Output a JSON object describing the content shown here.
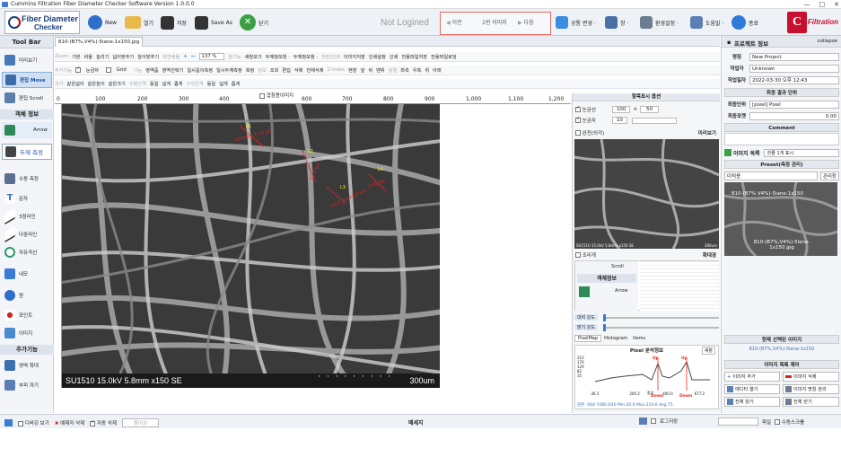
{
  "window": {
    "title": "Cummins Filtration Fiber Diameter Checker Software Version 1.0.0.0",
    "controls": [
      "—",
      "□",
      "✕"
    ]
  },
  "ribbon": {
    "logo_line1": "Fiber Diameter",
    "logo_line2": "Checker",
    "new": "New",
    "open": "열기",
    "save": "저장",
    "save_as": "Save As",
    "close": "닫기",
    "login_status": "Not Logined",
    "nav": {
      "prev": "이전",
      "page": "1번 이미지",
      "next": "다음"
    },
    "common_change": "공통 변경 ·",
    "window": "창 ·",
    "env_settings": "환경설정 ·",
    "help": "도움말 ·",
    "exit": "종료",
    "brand_logo": "C",
    "brand": "Filtration"
  },
  "left_toolbar": {
    "header": "Tool Bar",
    "items": [
      {
        "label": "미리보기"
      },
      {
        "label": "편집 Move"
      },
      {
        "label": "편집 Scroll"
      },
      {
        "label": "Arrow"
      },
      {
        "label": "두께 측정"
      },
      {
        "label": "수동 측정"
      },
      {
        "label": "문자"
      },
      {
        "label": "3점라인"
      },
      {
        "label": "다중라인"
      },
      {
        "label": "자유곡선"
      },
      {
        "label": "네모"
      },
      {
        "label": "원"
      },
      {
        "label": "포인트"
      },
      {
        "label": "이미지"
      },
      {
        "label": "영역 확대"
      },
      {
        "label": "부피 까기"
      }
    ],
    "section_object": "객체 정보",
    "section_extra": "추가기능"
  },
  "image_tab": "810-(B7%,V4%)-5lane-1x150.jpg",
  "toolbar_row1": [
    "Zoom",
    "기본",
    "비율",
    "늘리기",
    "넓이맞추기",
    "높이맞추기",
    "화면배율",
    "137 %",
    "창기능",
    "새창보기",
    "두께정보창 ·",
    "두께정보창 ·",
    "저장/인쇄",
    "이미지저장",
    "인쇄설정",
    "인쇄",
    "전용파일저장",
    "전용파일로딩"
  ],
  "toolbar_row2": [
    "추가기능",
    "눈금자",
    "Grid",
    "기능",
    "영역줌",
    "영역선택기",
    "일시길이측정",
    "일시두께측정",
    "측정",
    "정보",
    "조회",
    "편집",
    "삭제",
    "전체삭제",
    "Z-index",
    "현장",
    "앞",
    "뒤",
    "맨위",
    "정렬",
    "좌측",
    "우측",
    "위",
    "아래"
  ],
  "toolbar_row3": [
    "크기",
    "같은넓이",
    "같은높이",
    "같은크기",
    "수평간격",
    "동일",
    "넓게",
    "좁게",
    "수직간격",
    "동일",
    "넓게",
    "좁게"
  ],
  "ruler_label": "겹침용이미지",
  "ruler_ticks": [
    "0",
    "100",
    "200",
    "300",
    "400",
    "500",
    "600",
    "700",
    "800",
    "900",
    "1,000",
    "1,100",
    "1,200"
  ],
  "sem": {
    "info": "SU1510 15.0kV 5.8mm x150 SE",
    "scale": "300um",
    "labels": [
      "L1",
      "L2",
      "L3",
      "L4"
    ],
    "measurements": [
      "13.6mm 17.0 µm",
      "12.3 µm",
      "10.3 µm 19.2 µm",
      "14.0 µm"
    ]
  },
  "right_panel": {
    "display_options": "항목표시 옵션",
    "ruler": "눈금선",
    "ruler_values": [
      "100",
      "50"
    ],
    "ruler2": "눈금자",
    "ruler2_value": "10",
    "preview_check": "완전(외각)",
    "preview_title": "미리보기",
    "preview_caption": "SU1510 15.0kV 5.8mm x150 SE",
    "preview_scale": "300um",
    "zoom_check": "조리개",
    "zoom_title": "확대경",
    "zoom_scroll": "Scroll",
    "zoom_object": "객체정보",
    "zoom_arrow": "Arrow",
    "contrast": "대비 강도",
    "bright": "밝기 강도",
    "tabs": [
      "PixelMap",
      "Histogram",
      "Items"
    ],
    "pixel_title": "Pixel 분석정보",
    "refresh": "새창",
    "chart_y": [
      "223",
      "176",
      "129",
      "82",
      "35"
    ],
    "chart_x": [
      "-36.3",
      "200.2",
      "중앙",
      "400.0",
      "677.2"
    ],
    "chart_labels": {
      "up1": "Up",
      "up2": "Up",
      "down1": "Down",
      "down2": "Down"
    },
    "footer": "원본 :X64  Y(86):640   Min:20.0  Max:214.6  Avg:75."
  },
  "project_panel": {
    "header": "프로젝트 정보",
    "collapse": "collapse",
    "name_k": "명칭",
    "name_v": "New Project",
    "author_k": "작업자",
    "author_v": "Unknown",
    "date_k": "작업일자",
    "date_v": "2022-03-30 오후 12:43",
    "unit_head": "최종 결과 단위",
    "unit_k": "최종단위",
    "unit_v": "[pixel] Pixel",
    "val_k": "최종포켓",
    "val_v": "0.00",
    "comment_head": "Comment",
    "img_list": "이미지 목록",
    "img_list_opt": "한줄 1개 표시",
    "preset_head": "Preset(측정 관리)",
    "preset_v": "미적용",
    "preset_btn": "관리창",
    "thumb_label": "810-(B7% V4%)-5lane-1x150",
    "thumb_label2": "810-(B7%,V4%)-5lane-1x150.jpg",
    "current_head": "현재 선택된 이미지",
    "current_v": "810-(B7%,V4%)-5lane-1x150",
    "ctrl_head": "이미지 목록 제어",
    "btn_add": "이미지 추가",
    "btn_del": "이미지 삭제",
    "btn_editor": "에디터 열기",
    "btn_rename": "이미지 명칭 관리",
    "btn_allread": "전체 읽기",
    "btn_allopen": "전체 닫기"
  },
  "status": {
    "debug": "디버깅 보기",
    "delete_sel": "예제자 삭제",
    "auto_delete": "자동 삭제",
    "zoom_field": "줌이상",
    "message": "메세지",
    "logsave": "로그저장",
    "file": "파일",
    "manual": "수동스크롤"
  }
}
